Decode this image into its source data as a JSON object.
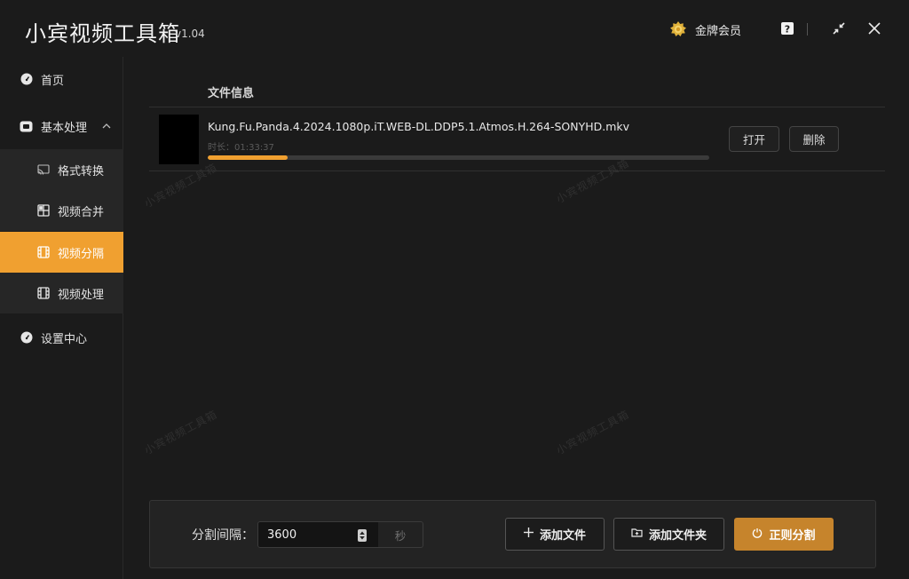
{
  "app": {
    "title": "小宾视频工具箱",
    "version": "v1.04"
  },
  "titlebar": {
    "vip_label": "金牌会员"
  },
  "sidebar": {
    "home": "首页",
    "basic": "基本处理",
    "sub_items": [
      {
        "label": "格式转换"
      },
      {
        "label": "视频合并"
      },
      {
        "label": "视频分隔"
      },
      {
        "label": "视频处理"
      }
    ],
    "settings": "设置中心"
  },
  "file_list": {
    "header": "文件信息",
    "files": [
      {
        "name": "Kung.Fu.Panda.4.2024.1080p.iT.WEB-DL.DDP5.1.Atmos.H.264-SONYHD.mkv",
        "duration": "时长：01:33:37",
        "progress": 0.16,
        "open_label": "打开",
        "delete_label": "删除"
      }
    ]
  },
  "watermark": "小宾视频工具箱",
  "bottom": {
    "interval_label": "分割间隔：",
    "interval_value": "3600",
    "unit": "秒",
    "add_file": "添加文件",
    "add_folder": "添加文件夹",
    "start": "正则分割"
  },
  "colors": {
    "accent": "#f0a030",
    "primary_button": "#c6842c",
    "background": "#1b1b1b"
  }
}
